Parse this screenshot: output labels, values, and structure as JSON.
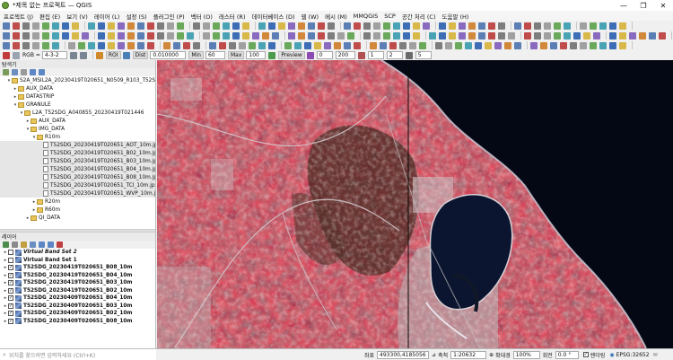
{
  "window": {
    "title": "*제목 없는 프로젝트 — QGIS",
    "controls": [
      "—",
      "❐",
      "✕"
    ]
  },
  "menu": [
    "프로젝트 (J)",
    "편집 (E)",
    "보기 (V)",
    "레이어 (L)",
    "설정 (S)",
    "플러그인 (P)",
    "벡터 (O)",
    "래스터 (R)",
    "데이터베이스 (D)",
    "웹 (W)",
    "메시 (M)",
    "MMQGIS",
    "SCP",
    "공간 처리 (C)",
    "도움말 (H)"
  ],
  "scp_toolbar": {
    "rgb_label": "RGB =",
    "rgb_value": "4-3-2",
    "roi_label": "ROI",
    "dist_label": "Dist",
    "dist_value": "0.010000",
    "min_label": "Min",
    "min_value": "60",
    "max_label": "Max",
    "max_value": "100",
    "preview_label": "Preview",
    "s1": "0",
    "s2": "200",
    "s3": "1",
    "s4": "2",
    "s5": "5"
  },
  "browser": {
    "title": "탐색기",
    "items": [
      {
        "label": "S2A_MSIL2A_20230419T020651_N0509_R103_T52SD",
        "indent": 1,
        "expanded": true,
        "type": "folder"
      },
      {
        "label": "AUX_DATA",
        "indent": 2,
        "expanded": false,
        "type": "folder"
      },
      {
        "label": "DATASTRIP",
        "indent": 2,
        "expanded": false,
        "type": "folder"
      },
      {
        "label": "GRANULE",
        "indent": 2,
        "expanded": true,
        "type": "folder"
      },
      {
        "label": "L2A_T52SDG_A040855_20230419T021446",
        "indent": 3,
        "expanded": true,
        "type": "folder"
      },
      {
        "label": "AUX_DATA",
        "indent": 4,
        "expanded": false,
        "type": "folder"
      },
      {
        "label": "IMG_DATA",
        "indent": 4,
        "expanded": true,
        "type": "folder"
      },
      {
        "label": "R10m",
        "indent": 5,
        "expanded": true,
        "type": "folder"
      },
      {
        "label": "T52SDG_20230419T020651_AOT_10m.jp2",
        "indent": 6,
        "type": "raster"
      },
      {
        "label": "T52SDG_20230419T020651_B02_10m.jp2",
        "indent": 6,
        "type": "raster"
      },
      {
        "label": "T52SDG_20230419T020651_B03_10m.jp2",
        "indent": 6,
        "type": "raster"
      },
      {
        "label": "T52SDG_20230419T020651_B04_10m.jp2",
        "indent": 6,
        "type": "raster"
      },
      {
        "label": "T52SDG_20230419T020651_B08_10m.jp2",
        "indent": 6,
        "type": "raster"
      },
      {
        "label": "T52SDG_20230419T020651_TCI_10m.jp2",
        "indent": 6,
        "type": "raster"
      },
      {
        "label": "T52SDG_20230419T020651_WVP_10m.jp2",
        "indent": 6,
        "type": "raster"
      },
      {
        "label": "R20m",
        "indent": 5,
        "expanded": false,
        "type": "folder"
      },
      {
        "label": "R60m",
        "indent": 5,
        "expanded": false,
        "type": "folder"
      },
      {
        "label": "QI_DATA",
        "indent": 4,
        "expanded": false,
        "type": "folder"
      }
    ]
  },
  "layers": {
    "title": "레이어",
    "items": [
      {
        "label": "Virtual Band Set 2",
        "italic": true,
        "checked": false
      },
      {
        "label": "Virtual Band Set 1",
        "italic": false,
        "checked": false
      },
      {
        "label": "T52SDG_20230419T020651_B08_10m",
        "checked": true
      },
      {
        "label": "T52SDG_20230419T020651_B04_10m",
        "checked": true
      },
      {
        "label": "T52SDG_20230419T020651_B03_10m",
        "checked": true
      },
      {
        "label": "T52SDG_20230419T020651_B02_10m",
        "checked": true
      },
      {
        "label": "T52SDG_20230409T020651_B04_10m",
        "checked": true
      },
      {
        "label": "T52SDG_20230409T020651_B03_10m",
        "checked": true
      },
      {
        "label": "T52SDG_20230409T020651_B02_10m",
        "checked": true
      },
      {
        "label": "T52SDG_20230409T020651_B08_10m",
        "checked": true
      }
    ]
  },
  "search": {
    "placeholder": "위치를 찾으려면 입력하세요 (Ctrl+K)"
  },
  "status": {
    "coord_label": "좌표",
    "coord_value": "493300,4185056",
    "scale_label": "축척",
    "scale_value": "1:20632",
    "magnifier_label": "확대경",
    "magnifier_value": "100%",
    "rotation_label": "회전",
    "rotation_value": "0.0 °",
    "render_label": "렌더링",
    "crs": "EPSG:32652"
  },
  "colors": {
    "veg_red": "#c8283e",
    "water": "#0b1530",
    "sea": "#040814"
  }
}
